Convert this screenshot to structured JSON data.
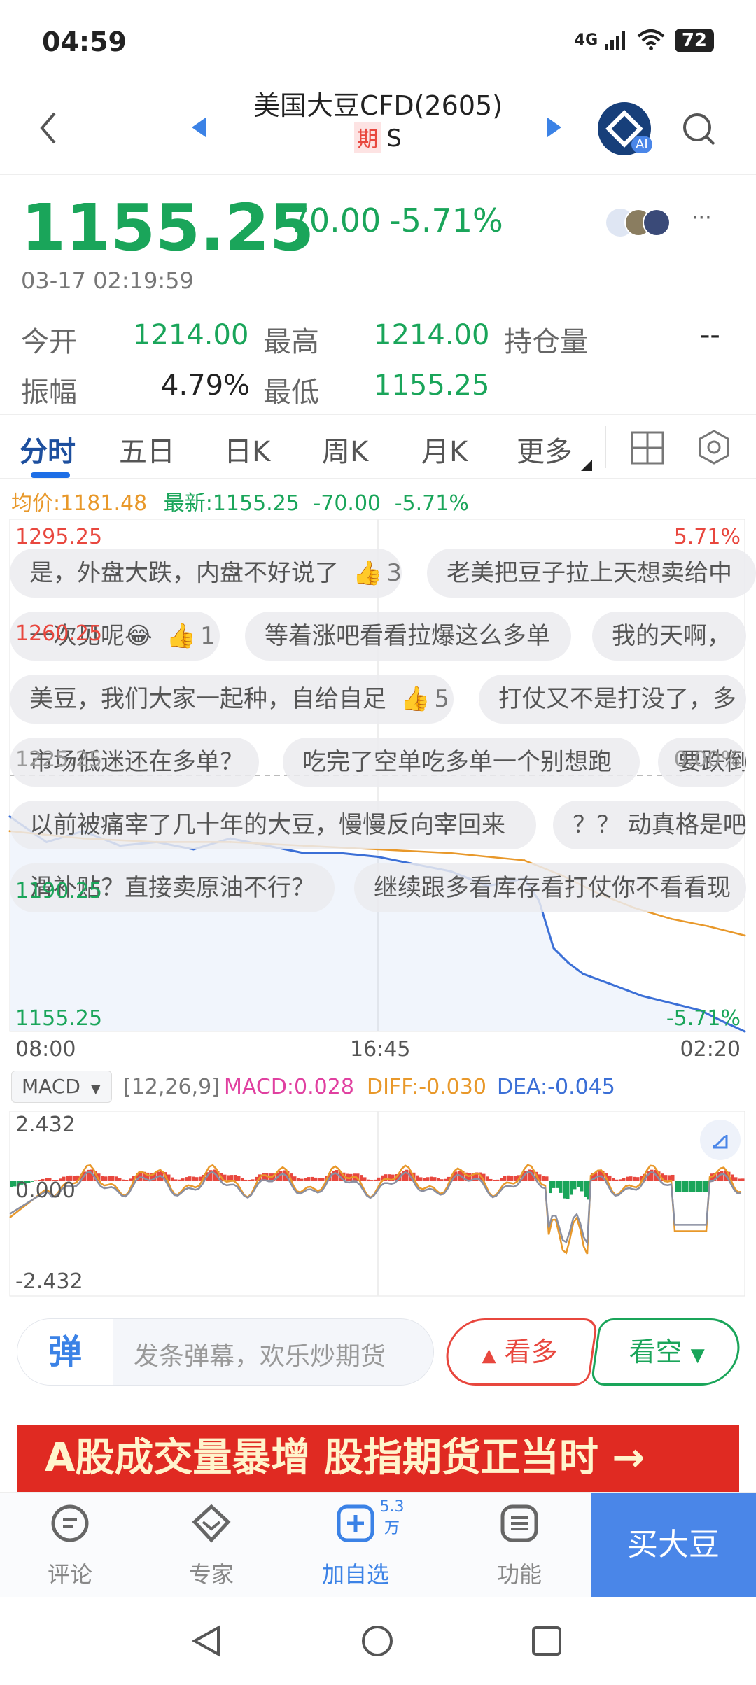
{
  "status_bar": {
    "time": "04:59",
    "network": "4G",
    "battery": "72"
  },
  "header": {
    "title": "美国大豆CFD(2605)",
    "badge": "期",
    "code": "S",
    "ai_label": "AI"
  },
  "quote": {
    "price": "1155.25",
    "change": "-70.00",
    "change_pct": "-5.71%",
    "timestamp": "03-17 02:19:59",
    "open_label": "今开",
    "open_value": "1214.00",
    "high_label": "最高",
    "high_value": "1214.00",
    "oi_label": "持仓量",
    "oi_value": "--",
    "amp_label": "振幅",
    "amp_value": "4.79%",
    "low_label": "最低",
    "low_value": "1155.25",
    "more_label": "···"
  },
  "tabs": [
    "分时",
    "五日",
    "日K",
    "周K",
    "月K",
    "更多"
  ],
  "chart_data": {
    "type": "line",
    "legend_avg": "均价:1181.48",
    "legend_latest": "最新:1155.25",
    "legend_change": "-70.00",
    "legend_pct": "-5.71%",
    "y_labels": [
      "1295.25",
      "1260.25",
      "1225.25",
      "1190.25",
      "1155.25"
    ],
    "right_labels": [
      "5.71%",
      "0.00%",
      "-5.71%"
    ],
    "x_labels": [
      "08:00",
      "16:45",
      "02:20"
    ],
    "ylim": [
      1155.25,
      1295.25
    ],
    "series": [
      {
        "name": "最新",
        "color": "#3b6fd6",
        "x": [
          0,
          0.05,
          0.1,
          0.15,
          0.2,
          0.25,
          0.3,
          0.35,
          0.4,
          0.45,
          0.5,
          0.55,
          0.6,
          0.65,
          0.7,
          0.72,
          0.74,
          0.76,
          0.78,
          0.82,
          0.86,
          0.9,
          0.94,
          0.97,
          1.0
        ],
        "values": [
          1214,
          1207,
          1210,
          1206,
          1207,
          1205,
          1208,
          1206,
          1204,
          1204,
          1203,
          1201,
          1199,
          1195,
          1197,
          1191,
          1178,
          1174,
          1171,
          1168,
          1165,
          1163,
          1161,
          1158,
          1155.25
        ]
      },
      {
        "name": "均价",
        "color": "#e8982a",
        "x": [
          0,
          0.1,
          0.2,
          0.3,
          0.4,
          0.5,
          0.6,
          0.7,
          0.75,
          0.8,
          0.85,
          0.9,
          0.95,
          1.0
        ],
        "values": [
          1210,
          1208,
          1207,
          1207,
          1206,
          1205,
          1204,
          1202,
          1198,
          1193,
          1189,
          1186,
          1184,
          1181.48
        ]
      }
    ]
  },
  "danmu": [
    {
      "text": "是，外盘大跌，内盘不好说了",
      "likes": "3"
    },
    {
      "text": "老美把豆子拉上天想卖给中",
      "likes": ""
    },
    {
      "text": "一次见呢😂",
      "likes": "1"
    },
    {
      "text": "等着涨吧看看拉爆这么多单",
      "likes": ""
    },
    {
      "text": "我的天啊，",
      "likes": ""
    },
    {
      "text": "美豆，我们大家一起种，自给自足",
      "likes": "5"
    },
    {
      "text": "打仗又不是打没了，多",
      "likes": ""
    },
    {
      "text": "市场低迷还在多单？",
      "likes": ""
    },
    {
      "text": "吃完了空单吃多单一个别想跑",
      "likes": ""
    },
    {
      "text": "要跌倒",
      "likes": ""
    },
    {
      "text": "以前被痛宰了几十年的大豆，慢慢反向宰回来",
      "likes": ""
    },
    {
      "text": "？？ 动真格是吧？",
      "likes": ""
    },
    {
      "text": "滑补贴？直接卖原油不行？",
      "likes": ""
    },
    {
      "text": "继续跟多看库存看打仗你不看看现",
      "likes": ""
    }
  ],
  "macd": {
    "indicator": "MACD",
    "params": "[12,26,9]",
    "macd": "MACD:0.028",
    "diff": "DIFF:-0.030",
    "dea": "DEA:-0.045",
    "y_top": "2.432",
    "y_mid": "0.000",
    "y_bot": "-2.432"
  },
  "input": {
    "danmu_icon": "弹",
    "placeholder": "发条弹幕，欢乐炒期货",
    "bull": "看多",
    "bear": "看空"
  },
  "banner": {
    "text": "A股成交量暴增 股指期货正当时 →"
  },
  "bottom_nav": {
    "comment": "评论",
    "expert": "专家",
    "add": "加自选",
    "add_count": "5.3万",
    "func": "功能",
    "buy": "买大豆"
  },
  "colors": {
    "green": "#1aa55a",
    "red": "#e8473e",
    "blue": "#3b6fd6",
    "orange": "#e8982a"
  }
}
